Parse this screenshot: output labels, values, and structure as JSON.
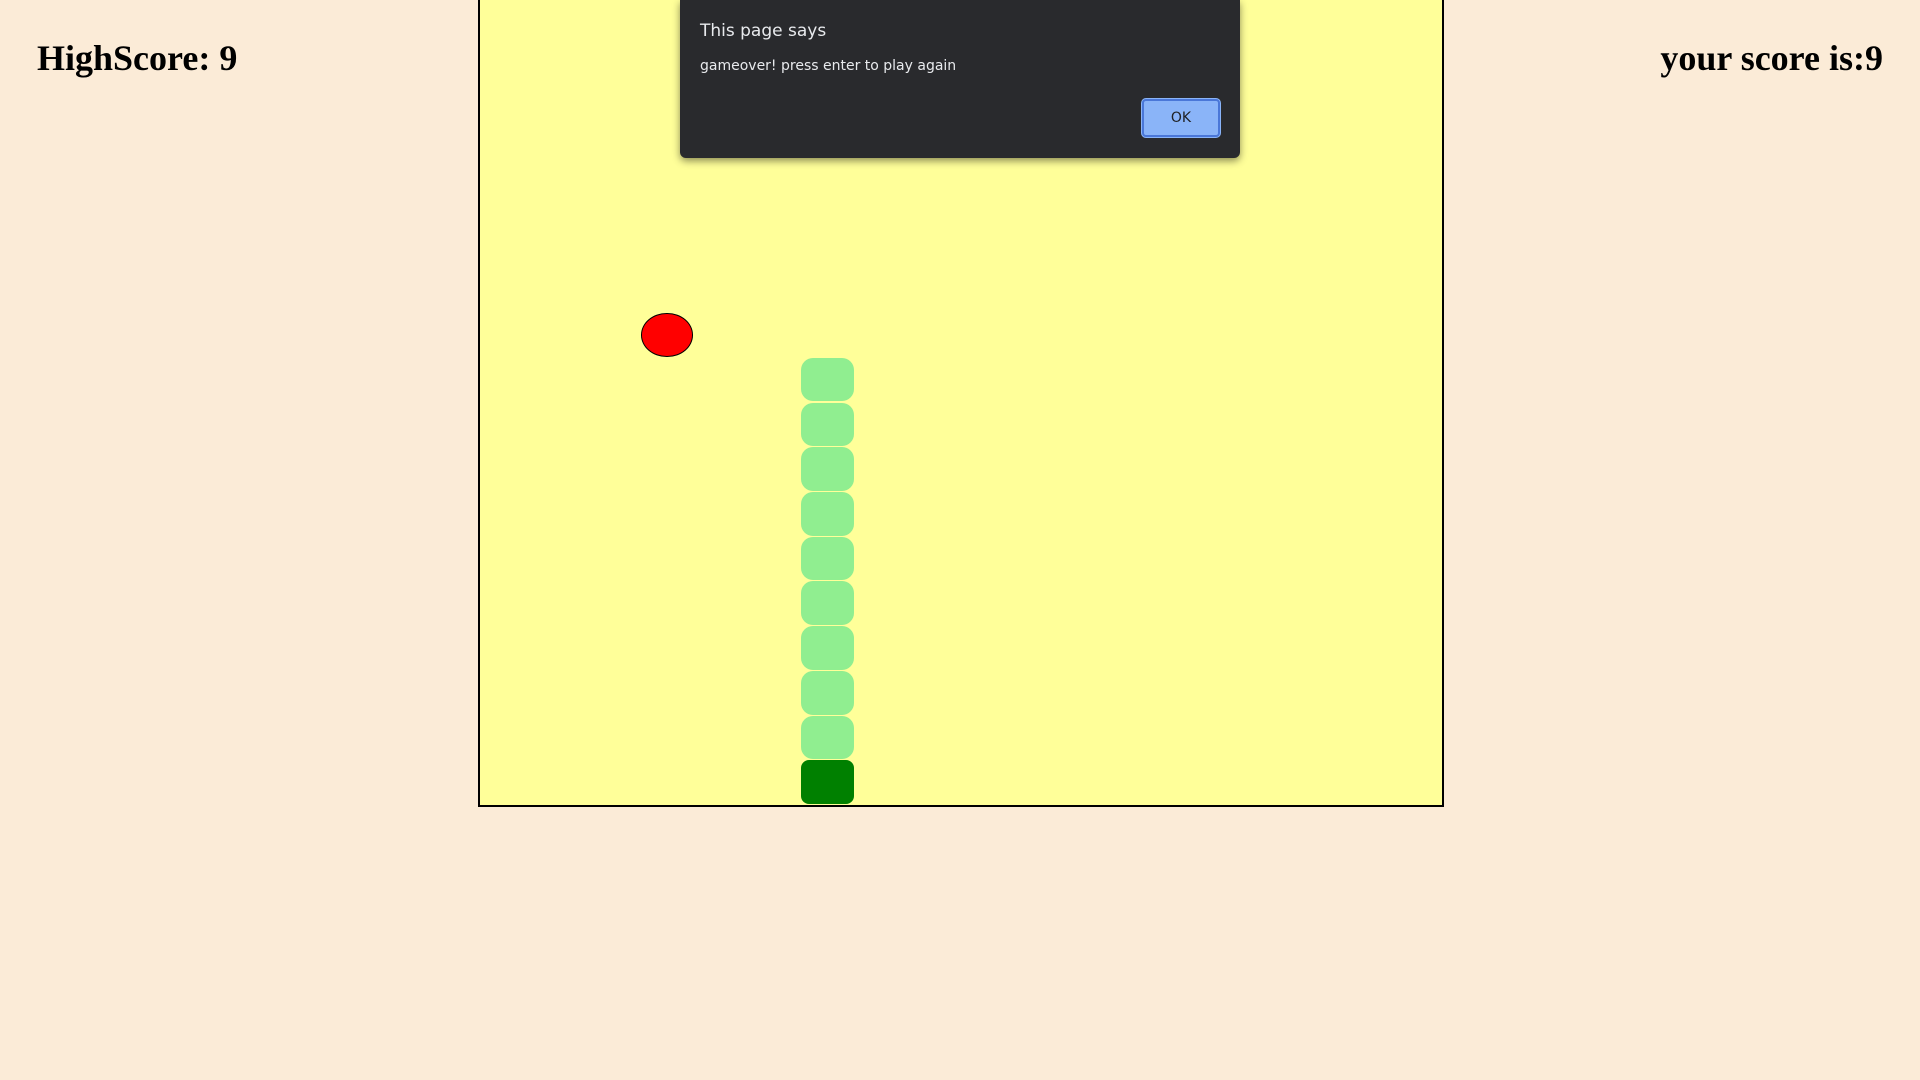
{
  "scores": {
    "high_score_label": "HighScore: 9",
    "your_score_label": "your score is:9"
  },
  "board": {
    "background": "#ffff99",
    "columns": 18,
    "rows": 18,
    "food_color": "#ff0000",
    "snake_body_color": "#90ee90",
    "snake_head_color": "#008000",
    "food": {
      "col": 4,
      "row": 8
    },
    "snake_head": {
      "col": 7,
      "row": 18
    },
    "snake_body": [
      {
        "col": 7,
        "row": 9
      },
      {
        "col": 7,
        "row": 10
      },
      {
        "col": 7,
        "row": 11
      },
      {
        "col": 7,
        "row": 12
      },
      {
        "col": 7,
        "row": 13
      },
      {
        "col": 7,
        "row": 14
      },
      {
        "col": 7,
        "row": 15
      },
      {
        "col": 7,
        "row": 16
      },
      {
        "col": 7,
        "row": 17
      }
    ]
  },
  "dialog": {
    "title": "This page says",
    "message": "gameover! press enter to play again",
    "ok_label": "OK"
  }
}
